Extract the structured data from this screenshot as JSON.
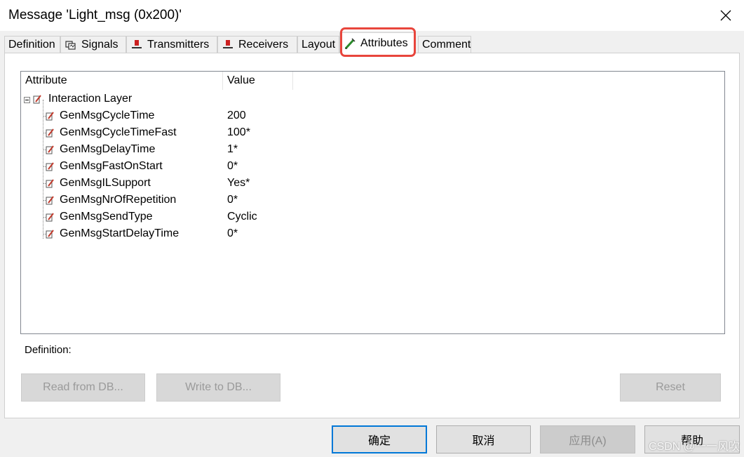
{
  "window": {
    "title": "Message 'Light_msg (0x200)'"
  },
  "tabs": [
    {
      "label": "Definition"
    },
    {
      "label": "Signals"
    },
    {
      "label": "Transmitters"
    },
    {
      "label": "Receivers"
    },
    {
      "label": "Layout"
    },
    {
      "label": "Attributes"
    },
    {
      "label": "Comment"
    }
  ],
  "active_tab": "Attributes",
  "highlight_color": "#e8453c",
  "table": {
    "col_attribute": "Attribute",
    "col_value": "Value",
    "group": "Interaction Layer",
    "rows": [
      {
        "name": "GenMsgCycleTime",
        "value": "200"
      },
      {
        "name": "GenMsgCycleTimeFast",
        "value": "100*"
      },
      {
        "name": "GenMsgDelayTime",
        "value": "1*"
      },
      {
        "name": "GenMsgFastOnStart",
        "value": "0*"
      },
      {
        "name": "GenMsgILSupport",
        "value": "Yes*"
      },
      {
        "name": "GenMsgNrOfRepetition",
        "value": "0*"
      },
      {
        "name": "GenMsgSendType",
        "value": "Cyclic"
      },
      {
        "name": "GenMsgStartDelayTime",
        "value": "0*"
      }
    ]
  },
  "definition_label": "Definition:",
  "buttons": {
    "read_from_db": "Read from DB...",
    "write_to_db": "Write to DB...",
    "reset": "Reset"
  },
  "footer": {
    "ok": "确定",
    "cancel": "取消",
    "apply": "应用(A)",
    "help": "帮助"
  },
  "watermark": "CSDN @一一风吹"
}
